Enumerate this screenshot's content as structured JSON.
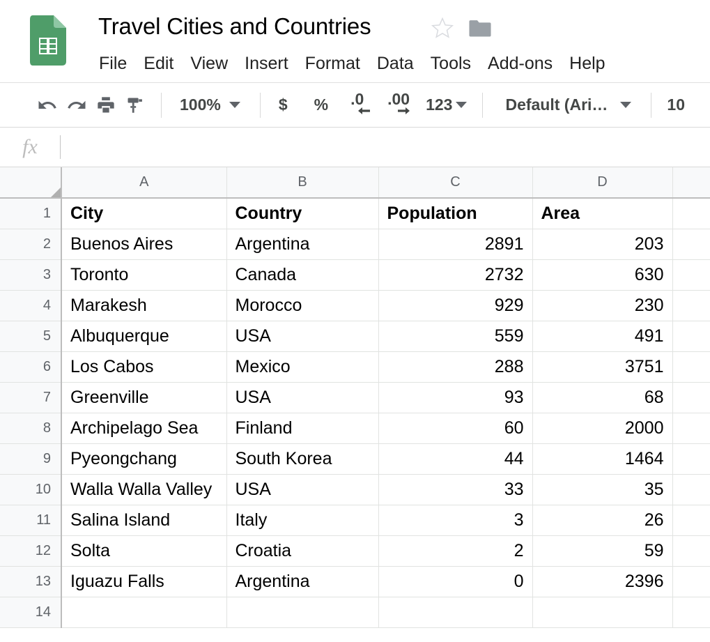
{
  "header": {
    "logo_icon": "google-sheets-logo",
    "doc_title": "Travel Cities and Countries",
    "star_icon": "star-outline-icon",
    "folder_icon": "folder-icon",
    "menus": [
      {
        "label": "File"
      },
      {
        "label": "Edit"
      },
      {
        "label": "View"
      },
      {
        "label": "Insert"
      },
      {
        "label": "Format"
      },
      {
        "label": "Data"
      },
      {
        "label": "Tools"
      },
      {
        "label": "Add-ons"
      },
      {
        "label": "Help"
      }
    ]
  },
  "toolbar": {
    "undo_icon": "undo-icon",
    "redo_icon": "redo-icon",
    "print_icon": "print-icon",
    "paint_format_icon": "paint-format-icon",
    "zoom_value": "100%",
    "currency_label": "$",
    "percent_label": "%",
    "decrease_decimal_label": ".0",
    "increase_decimal_label": ".00",
    "more_formats_label": "123",
    "font_value": "Default (Ari…",
    "font_size_value": "10"
  },
  "formula_bar": {
    "fx_label": "fx",
    "value": "",
    "placeholder": ""
  },
  "grid": {
    "column_headers": [
      "A",
      "B",
      "C",
      "D",
      ""
    ],
    "row_numbers": [
      "1",
      "2",
      "3",
      "4",
      "5",
      "6",
      "7",
      "8",
      "9",
      "10",
      "11",
      "12",
      "13",
      "14"
    ],
    "header_row": {
      "A": "City",
      "B": "Country",
      "C": "Population",
      "D": "Area"
    },
    "rows": [
      {
        "row": "2",
        "city": "Buenos Aires",
        "country": "Argentina",
        "population": "2891",
        "area": "203"
      },
      {
        "row": "3",
        "city": "Toronto",
        "country": "Canada",
        "population": "2732",
        "area": "630"
      },
      {
        "row": "4",
        "city": "Marakesh",
        "country": "Morocco",
        "population": "929",
        "area": "230"
      },
      {
        "row": "5",
        "city": "Albuquerque",
        "country": "USA",
        "population": "559",
        "area": "491"
      },
      {
        "row": "6",
        "city": "Los Cabos",
        "country": "Mexico",
        "population": "288",
        "area": "3751"
      },
      {
        "row": "7",
        "city": "Greenville",
        "country": "USA",
        "population": "93",
        "area": "68"
      },
      {
        "row": "8",
        "city": "Archipelago Sea",
        "country": "Finland",
        "population": "60",
        "area": "2000"
      },
      {
        "row": "9",
        "city": "Pyeongchang",
        "country": "South Korea",
        "population": "44",
        "area": "1464"
      },
      {
        "row": "10",
        "city": "Walla Walla Valley",
        "country": "USA",
        "population": "33",
        "area": "35"
      },
      {
        "row": "11",
        "city": "Salina Island",
        "country": "Italy",
        "population": "3",
        "area": "26"
      },
      {
        "row": "12",
        "city": "Solta",
        "country": "Croatia",
        "population": "2",
        "area": "59"
      },
      {
        "row": "13",
        "city": "Iguazu Falls",
        "country": "Argentina",
        "population": "0",
        "area": "2396"
      },
      {
        "row": "14",
        "city": "",
        "country": "",
        "population": "",
        "area": ""
      }
    ]
  },
  "colors": {
    "sheets_green": "#4f9d69",
    "header_bg": "#f8f9fa",
    "grid_line": "#e1e3e1",
    "icon_gray": "#5f6368"
  }
}
